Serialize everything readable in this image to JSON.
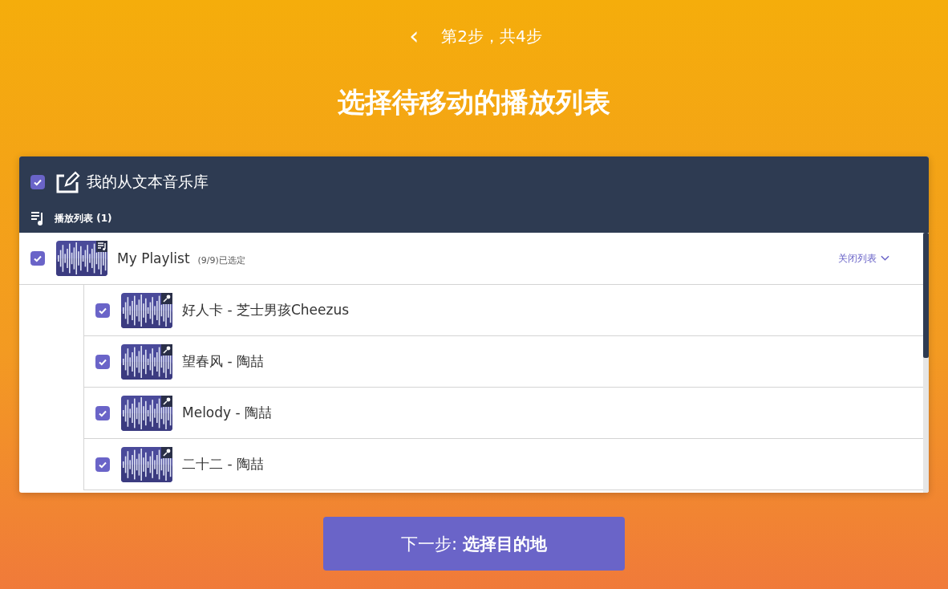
{
  "nav": {
    "back": "‹",
    "step": "第2步，共4步"
  },
  "title": "选择待移动的播放列表",
  "library": {
    "name": "我的从文本音乐库",
    "checked": true
  },
  "section": {
    "label": "播放列表 (1)"
  },
  "playlist": {
    "name": "My Playlist",
    "count": "(9/9)已选定",
    "checked": true,
    "toggle": "关闭列表"
  },
  "tracks": [
    {
      "title": "好人卡 - 芝士男孩Cheezus",
      "checked": true
    },
    {
      "title": "望春风 - 陶喆",
      "checked": true
    },
    {
      "title": "Melody - 陶喆",
      "checked": true
    },
    {
      "title": "二十二 - 陶喆",
      "checked": true
    }
  ],
  "next_button": "下一步: **选择目的地**"
}
